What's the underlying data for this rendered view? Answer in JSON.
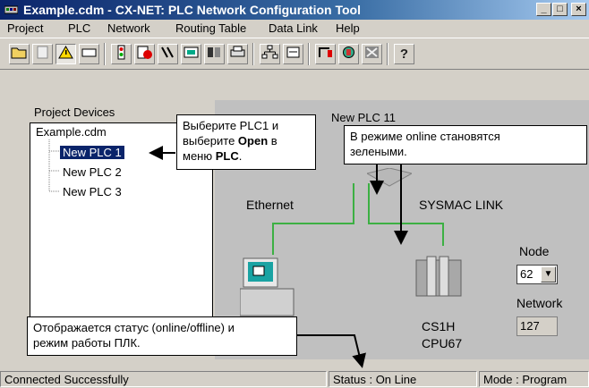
{
  "window": {
    "title": "Example.cdm - CX-NET: PLC Network Configuration Tool"
  },
  "menu": [
    {
      "label": "Project"
    },
    {
      "label": "PLC"
    },
    {
      "label": "Network"
    },
    {
      "label": "Routing Table"
    },
    {
      "label": "Data Link"
    },
    {
      "label": "Help"
    }
  ],
  "toolbar_icons": [
    "open-icon",
    "properties-icon",
    "warning-icon",
    "online-icon",
    "plc-icon",
    "stop-icon",
    "compare-icon",
    "transfer-icon",
    "io-icon",
    "print-icon",
    "network-icon",
    "link-icon",
    "routing-icon",
    "monitor-icon",
    "config-icon",
    "help-icon"
  ],
  "tree": {
    "panel_label": "Project Devices",
    "root": "Example.cdm",
    "items": [
      {
        "label": "New PLC 1"
      },
      {
        "label": "New PLC 2"
      },
      {
        "label": "New PLC 3"
      }
    ]
  },
  "diagram": {
    "plc_title": "New PLC 11",
    "ethernet_label": "Ethernet",
    "sysmac_label": "SYSMAC LINK",
    "node_label": "Node",
    "node_value": "62",
    "network_label": "Network",
    "network_value": "127",
    "plc_model": "CS1H",
    "plc_cpu": "CPU67"
  },
  "callouts": {
    "open": {
      "line1": "Выберите PLC1 и",
      "line2_pre": "выберите ",
      "line2_bold": "Open",
      "line2_post": " в",
      "line3_pre": "меню ",
      "line3_bold": "PLC",
      "line3_post": "."
    },
    "online": {
      "line1": "В режиме online становятся",
      "line2": "зелеными."
    },
    "status": {
      "line1": "Отображается статус (online/offline) и",
      "line2": "режим работы ПЛК."
    }
  },
  "status": {
    "message": "Connected Successfully",
    "status": "Status : On Line",
    "mode": "Mode : Program"
  },
  "colors": {
    "selection": "#0a246a",
    "link_line": "#3cb043",
    "title_start": "#0a246a"
  }
}
